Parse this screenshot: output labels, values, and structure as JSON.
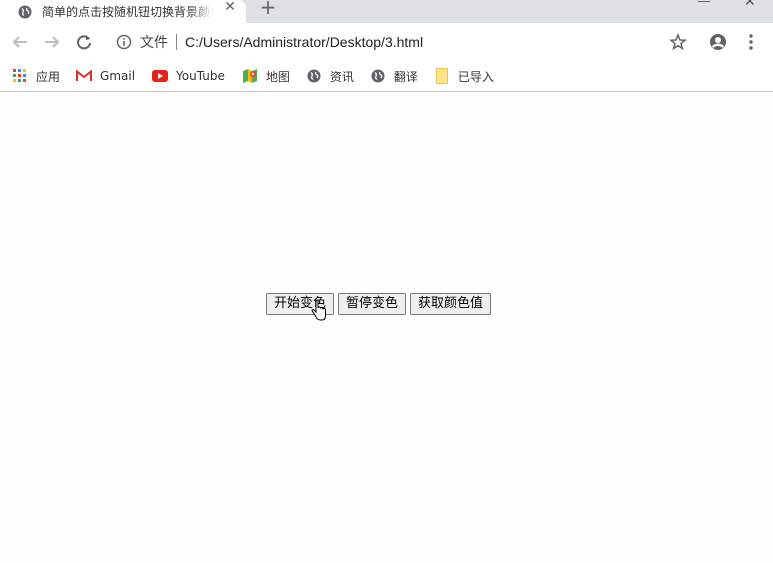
{
  "tab": {
    "title": "简单的点击按随机钮切换背景颜色",
    "close_glyph": "✕",
    "new_tab_glyph": "+"
  },
  "window": {
    "close_glyph": "✕"
  },
  "toolbar": {
    "scheme_label": "文件",
    "url": "C:/Users/Administrator/Desktop/3.html"
  },
  "bookmarks": [
    {
      "label": "应用",
      "icon": "apps-grid-icon"
    },
    {
      "label": "Gmail",
      "icon": "gmail-icon"
    },
    {
      "label": "YouTube",
      "icon": "youtube-icon"
    },
    {
      "label": "地图",
      "icon": "maps-icon"
    },
    {
      "label": "资讯",
      "icon": "globe-icon"
    },
    {
      "label": "翻译",
      "icon": "globe-icon"
    },
    {
      "label": "已导入",
      "icon": "folder-icon"
    }
  ],
  "page": {
    "buttons": [
      {
        "label": "开始变色"
      },
      {
        "label": "暂停变色"
      },
      {
        "label": "获取颜色值"
      }
    ]
  },
  "colors": {
    "tabstrip_bg": "#dee1e6",
    "page_bg": "#fdfdfd",
    "button_bg": "#efefef"
  }
}
